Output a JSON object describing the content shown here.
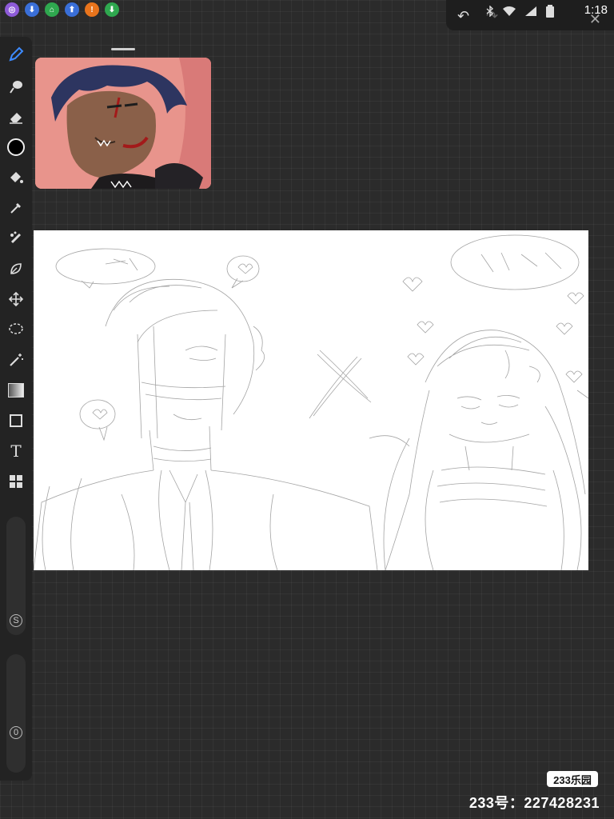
{
  "status_bar": {
    "time": "1:18",
    "notification_icons": [
      {
        "name": "app-notification-icon-1",
        "color": "#8e5bd8",
        "glyph": "◎"
      },
      {
        "name": "download-notification-icon-1",
        "color": "#3a6fd8",
        "glyph": "⬇"
      },
      {
        "name": "app-notification-icon-2",
        "color": "#2fa84f",
        "glyph": "⌂"
      },
      {
        "name": "upload-notification-icon",
        "color": "#3a6fd8",
        "glyph": "⬆"
      },
      {
        "name": "alert-notification-icon",
        "color": "#e8741c",
        "glyph": "!"
      },
      {
        "name": "download-notification-icon-2",
        "color": "#2fa84f",
        "glyph": "⬇"
      }
    ],
    "system_icons": [
      "bluetooth-icon",
      "wifi-icon",
      "signal-icon",
      "battery-icon"
    ]
  },
  "canvas_actions": {
    "undo_icon": "undo-icon",
    "redo_icon": "redo-icon",
    "close_icon": "close-icon"
  },
  "toolbar": {
    "tools": [
      "brush-tool-icon",
      "smudge-tool-icon",
      "eraser-tool-icon",
      "color-swatch-icon",
      "fill-bucket-icon",
      "eyedropper-icon",
      "blend-brush-icon",
      "liquify-icon",
      "transform-icon",
      "lasso-select-icon",
      "magic-wand-icon",
      "gradient-icon",
      "rectangle-icon",
      "text-tool-icon",
      "layers-icon"
    ],
    "active_tool": "brush-tool-icon",
    "accent_color": "#3d8bff",
    "size_knob_label": "S",
    "opacity_knob_label": "0"
  },
  "watermark": {
    "logo": "233乐园",
    "text": "233号：227428231"
  }
}
